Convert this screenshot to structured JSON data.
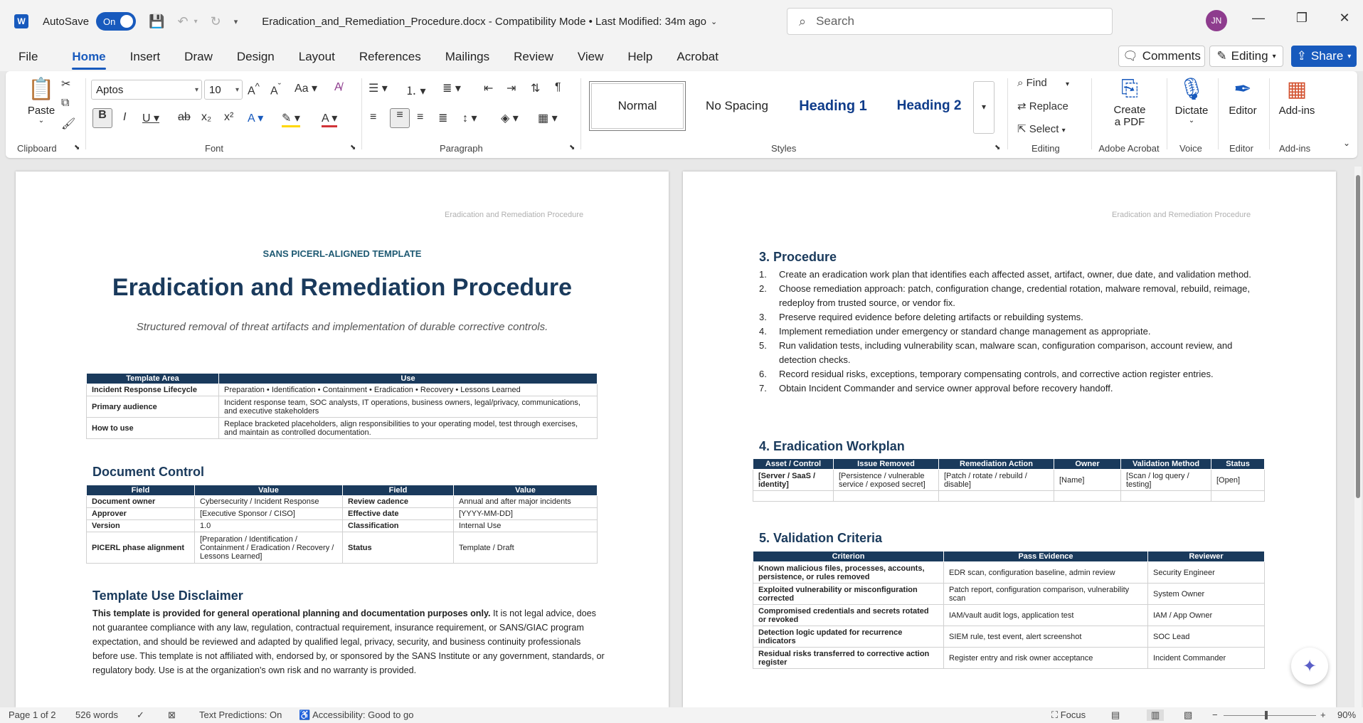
{
  "titlebar": {
    "autosave_label": "AutoSave",
    "autosave_state": "On",
    "doc_title": "Eradication_and_Remediation_Procedure.docx  -  Compatibility Mode  •  Last Modified: 34m ago",
    "search_placeholder": "Search",
    "avatar": "JN"
  },
  "menu": {
    "tabs": [
      "File",
      "Home",
      "Insert",
      "Draw",
      "Design",
      "Layout",
      "References",
      "Mailings",
      "Review",
      "View",
      "Help",
      "Acrobat"
    ],
    "comments": "Comments",
    "editing": "Editing",
    "share": "Share"
  },
  "ribbon": {
    "clipboard": {
      "paste": "Paste",
      "label": "Clipboard"
    },
    "font": {
      "name": "Aptos",
      "size": "10",
      "label": "Font"
    },
    "paragraph": {
      "label": "Paragraph"
    },
    "styles": {
      "items": [
        "Normal",
        "No Spacing",
        "Heading 1",
        "Heading 2"
      ],
      "label": "Styles"
    },
    "editing": {
      "find": "Find",
      "replace": "Replace",
      "select": "Select",
      "label": "Editing"
    },
    "acrobat": {
      "btn": "Create\na PDF",
      "label": "Adobe Acrobat"
    },
    "voice": {
      "btn": "Dictate",
      "label": "Voice"
    },
    "editor": {
      "btn": "Editor",
      "label": "Editor"
    },
    "addins": {
      "btn": "Add-ins",
      "label": "Add-ins"
    }
  },
  "page1": {
    "header": "Eradication and Remediation Procedure",
    "kicker": "SANS PICERL-ALIGNED TEMPLATE",
    "title": "Eradication and Remediation Procedure",
    "subtitle": "Structured removal of threat artifacts and implementation of durable corrective controls.",
    "overview": {
      "headers": [
        "Template Area",
        "Use"
      ],
      "rows": [
        [
          "Incident Response Lifecycle",
          "Preparation • Identification • Containment • Eradication • Recovery • Lessons Learned"
        ],
        [
          "Primary audience",
          "Incident response team, SOC analysts, IT operations, business owners, legal/privacy, communications, and executive stakeholders"
        ],
        [
          "How to use",
          "Replace bracketed placeholders, align responsibilities to your operating model, test through exercises, and maintain as controlled documentation."
        ]
      ]
    },
    "doc_control_heading": "Document Control",
    "doc_control": {
      "headers": [
        "Field",
        "Value",
        "Field",
        "Value"
      ],
      "rows": [
        [
          "Document owner",
          "Cybersecurity / Incident Response",
          "Review cadence",
          "Annual and after major incidents"
        ],
        [
          "Approver",
          "[Executive Sponsor / CISO]",
          "Effective date",
          "[YYYY-MM-DD]"
        ],
        [
          "Version",
          "1.0",
          "Classification",
          "Internal Use"
        ],
        [
          "PICERL phase alignment",
          "[Preparation / Identification / Containment / Eradication / Recovery / Lessons Learned]",
          "Status",
          "Template / Draft"
        ]
      ]
    },
    "disclaimer_heading": "Template Use Disclaimer",
    "disclaimer_bold": "This template is provided for general operational planning and documentation purposes only.",
    "disclaimer_text": " It is not legal advice, does not guarantee compliance with any law, regulation, contractual requirement, insurance requirement, or SANS/GIAC program expectation, and should be reviewed and adapted by qualified legal, privacy, security, and business continuity professionals before use. This template is not affiliated with, endorsed by, or sponsored by the SANS Institute or any government, standards, or regulatory body. Use is at the organization's own risk and no warranty is provided."
  },
  "page2": {
    "header": "Eradication and Remediation Procedure",
    "procedure_heading": "3. Procedure",
    "procedure": [
      "Create an eradication work plan that identifies each affected asset, artifact, owner, due date, and validation method.",
      "Choose remediation approach: patch, configuration change, credential rotation, malware removal, rebuild, reimage, redeploy from trusted source, or vendor fix.",
      "Preserve required evidence before deleting artifacts or rebuilding systems.",
      "Implement remediation under emergency or standard change management as appropriate.",
      "Run validation tests, including vulnerability scan, malware scan, configuration comparison, account review, and detection checks.",
      "Record residual risks, exceptions, temporary compensating controls, and corrective action register entries.",
      "Obtain Incident Commander and service owner approval before recovery handoff."
    ],
    "workplan_heading": "4. Eradication Workplan",
    "workplan": {
      "headers": [
        "Asset / Control",
        "Issue Removed",
        "Remediation Action",
        "Owner",
        "Validation Method",
        "Status"
      ],
      "rows": [
        [
          "[Server / SaaS / identity]",
          "[Persistence / vulnerable service / exposed secret]",
          "[Patch / rotate / rebuild / disable]",
          "[Name]",
          "[Scan / log query / testing]",
          "[Open]"
        ],
        [
          "",
          "",
          "",
          "",
          "",
          ""
        ]
      ]
    },
    "validation_heading": "5. Validation Criteria",
    "validation": {
      "headers": [
        "Criterion",
        "Pass Evidence",
        "Reviewer"
      ],
      "rows": [
        [
          "Known malicious files, processes, accounts, persistence, or rules removed",
          "EDR scan, configuration baseline, admin review",
          "Security Engineer"
        ],
        [
          "Exploited vulnerability or misconfiguration corrected",
          "Patch report, configuration comparison, vulnerability scan",
          "System Owner"
        ],
        [
          "Compromised credentials and secrets rotated or revoked",
          "IAM/vault audit logs, application test",
          "IAM / App Owner"
        ],
        [
          "Detection logic updated for recurrence indicators",
          "SIEM rule, test event, alert screenshot",
          "SOC Lead"
        ],
        [
          "Residual risks transferred to corrective action register",
          "Register entry and risk owner acceptance",
          "Incident Commander"
        ]
      ]
    }
  },
  "status": {
    "page": "Page 1 of 2",
    "words": "526 words",
    "predictions": "Text Predictions: On",
    "accessibility": "Accessibility: Good to go",
    "focus": "Focus",
    "zoom": "90%"
  }
}
